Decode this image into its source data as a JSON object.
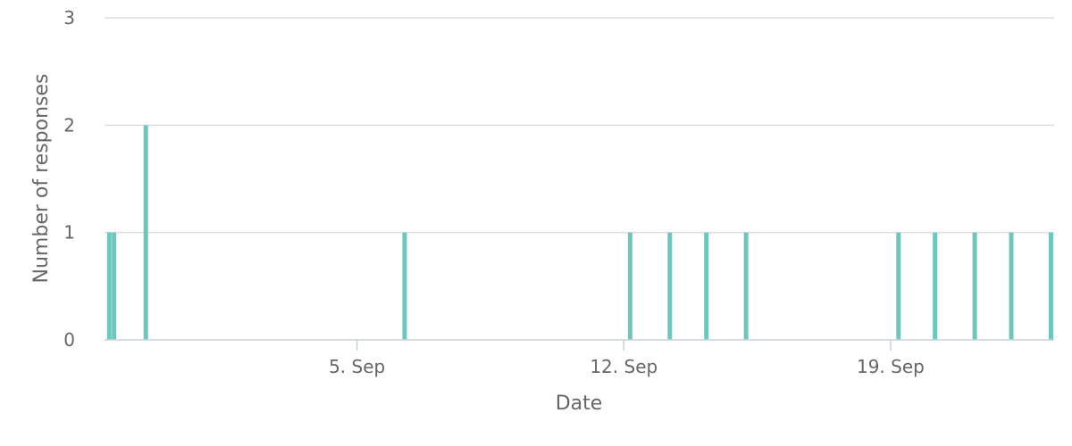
{
  "chart_data": {
    "type": "bar",
    "title": "",
    "xlabel": "Date",
    "ylabel": "Number of responses",
    "ylim": [
      0,
      3
    ],
    "xlim": [
      "2024-08-29T09:00",
      "2024-09-23T07:00"
    ],
    "y_ticks": [
      "0",
      "1",
      "2",
      "3"
    ],
    "x_ticks": [
      {
        "date": "2024-09-05",
        "label": "5. Sep"
      },
      {
        "date": "2024-09-12",
        "label": "12. Sep"
      },
      {
        "date": "2024-09-19",
        "label": "19. Sep"
      }
    ],
    "grid": true,
    "legend": "none",
    "bar_color": "#6cc8bc",
    "grid_color": "#dddddd",
    "axis_color": "#c7d0e0",
    "series": [
      {
        "x": [
          "2024-08-29T12:00",
          "2024-08-29T15:00",
          "2024-08-30T11:00",
          "2024-09-06T06:00",
          "2024-09-12T04:00",
          "2024-09-13T05:00",
          "2024-09-14T04:00",
          "2024-09-15T05:00",
          "2024-09-19T05:00",
          "2024-09-20T04:00",
          "2024-09-21T05:00",
          "2024-09-22T04:00",
          "2024-09-23T05:00"
        ],
        "values": [
          1,
          1,
          2,
          1,
          1,
          1,
          1,
          1,
          1,
          1,
          1,
          1,
          1
        ]
      }
    ]
  }
}
